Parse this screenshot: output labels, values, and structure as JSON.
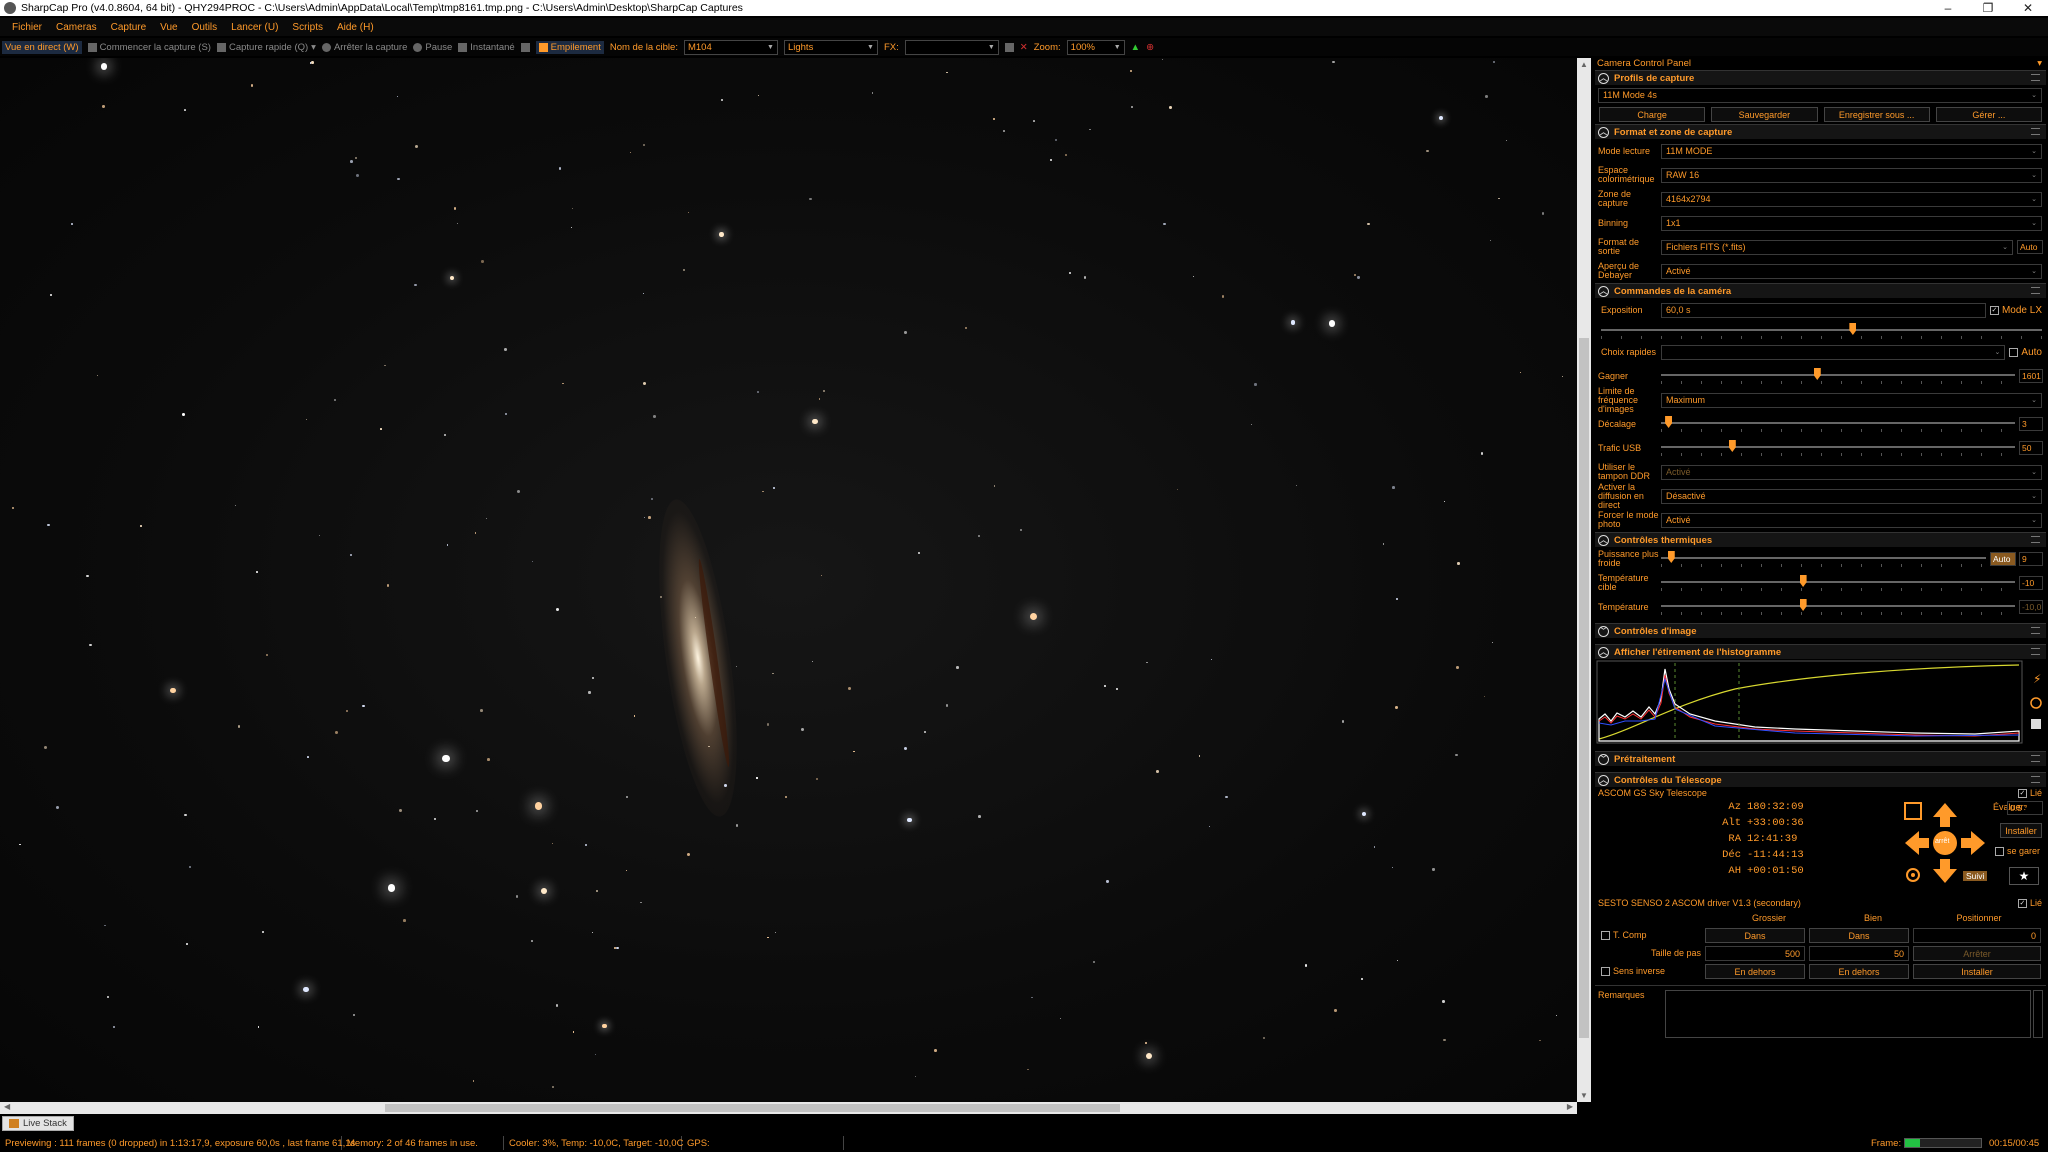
{
  "window": {
    "title": "SharpCap Pro (v4.0.8604, 64 bit) - QHY294PROC - C:\\Users\\Admin\\AppData\\Local\\Temp\\tmp8161.tmp.png - C:\\Users\\Admin\\Desktop\\SharpCap Captures",
    "minimize": "–",
    "restore": "❐",
    "close": "✕"
  },
  "menu": [
    "Fichier",
    "Cameras",
    "Capture",
    "Vue",
    "Outils",
    "Lancer (U)",
    "Scripts",
    "Aide (H)"
  ],
  "toolbar": {
    "live": "Vue en direct (W)",
    "start": "Commencer la capture (S)",
    "quick": "Capture rapide (Q)",
    "stop": "Arrêter la capture",
    "pause": "Pause",
    "snapshot": "Instantané",
    "stack": "Empilement",
    "target_label": "Nom de la cible:",
    "target_value": "M104",
    "frame_type": "Lights",
    "fx_label": "FX:",
    "fx_value": "",
    "zoom_label": "Zoom:",
    "zoom_value": "100%"
  },
  "panel": {
    "title": "Camera Control Panel",
    "pin": "📌",
    "profiles": {
      "header": "Profils de capture",
      "selected": "11M Mode 4s",
      "buttons": [
        "Charge",
        "Sauvegarder",
        "Enregistrer sous ...",
        "Gérer ..."
      ]
    },
    "format": {
      "header": "Format et zone de capture",
      "rows": [
        {
          "label": "Mode lecture",
          "value": "11M MODE"
        },
        {
          "label": "Espace colorimétrique",
          "value": "RAW 16"
        },
        {
          "label": "Zone de capture",
          "value": "4164x2794"
        },
        {
          "label": "Binning",
          "value": "1x1"
        },
        {
          "label": "Format de sortie",
          "value": "Fichiers FITS (*.fits)",
          "extra": "Auto"
        },
        {
          "label": "Aperçu de Debayer",
          "value": "Activé"
        }
      ]
    },
    "camera": {
      "header": "Commandes de la caméra",
      "exposure_label": "Exposition",
      "exposure_value": "60,0 s",
      "mode_lx": "Mode LX",
      "exposure_level": 0.57,
      "quick_label": "Choix rapides",
      "quick_value": "",
      "auto": "Auto",
      "gain_label": "Gagner",
      "gain_value": "1601",
      "gain_level": 0.44,
      "fps_label": "Limite de fréquence d'images",
      "fps_value": "Maximum",
      "offset_label": "Décalage",
      "offset_value": "3",
      "offset_level": 0.02,
      "usb_label": "Trafic USB",
      "usb_value": "50",
      "usb_level": 0.2,
      "ddr_label": "Utiliser le tampon DDR",
      "ddr_value": "Activé",
      "stream_label": "Activer la diffusion en direct",
      "stream_value": "Désactivé",
      "photo_label": "Forcer le mode photo",
      "photo_value": "Activé"
    },
    "thermal": {
      "header": "Contrôles thermiques",
      "power_label": "Puissance plus froide",
      "power_auto": "Auto",
      "power_value": "9",
      "power_level": 0.03,
      "target_label": "Température cible",
      "target_value": "-10",
      "target_level": 0.4,
      "temp_label": "Température",
      "temp_value": "-10,0",
      "temp_level": 0.4
    },
    "image": {
      "header": "Contrôles d'image"
    },
    "histogram": {
      "header": "Afficher l'étirement de l'histogramme"
    },
    "preprocess": {
      "header": "Prétraitement"
    },
    "telescope": {
      "header": "Contrôles du Télescope",
      "name": "ASCOM GS Sky Telescope",
      "linked": "Lié",
      "coords": [
        {
          "k": "Az",
          "v": "180:32:09"
        },
        {
          "k": "Alt",
          "v": "+33:00:36"
        },
        {
          "k": "RA",
          "v": "12:41:39"
        },
        {
          "k": "Déc",
          "v": "-11:44:13"
        },
        {
          "k": "AH",
          "v": "+00:01:50"
        }
      ],
      "rate_label": "Évaluer:",
      "rate_value": "0.5 °",
      "install": "Installer",
      "park": "se garer",
      "center": "arrêt",
      "follow": "Suivi"
    },
    "focuser": {
      "name": "SESTO SENSO 2 ASCOM driver V1.3 (secondary)",
      "linked": "Lié",
      "cols": [
        "Grossier",
        "Bien",
        "Positionner"
      ],
      "tcomp": "T. Comp",
      "in": "Dans",
      "position": "0",
      "step_label": "Taille de pas",
      "step_coarse": "500",
      "step_fine": "50",
      "stop": "Arrêter",
      "reverse": "Sens inverse",
      "out": "En dehors",
      "install": "Installer"
    },
    "notes_label": "Remarques"
  },
  "status": {
    "tab": "Live Stack",
    "preview": "Previewing : 111 frames (0 dropped) in 1:13:17,9, exposure 60,0s , last frame 61,1s",
    "memory": "Memory: 2 of 46 frames in use.",
    "cooler": "Cooler: 3%, Temp: -10,0C, Target: -10,0C",
    "gps": "GPS:",
    "frame_label": "Frame:",
    "frame_progress": 0.2,
    "time": "00:15/00:45"
  },
  "colors": {
    "accent": "#ff9a2a",
    "background": "#000000",
    "progress": "#23c043"
  }
}
